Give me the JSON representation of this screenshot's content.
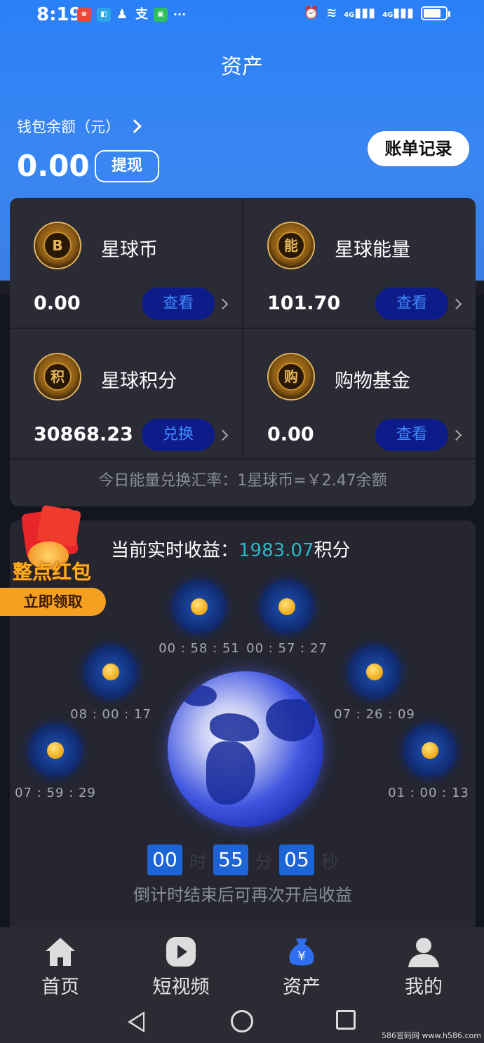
{
  "status_bar": {
    "time": "8:19",
    "dots": "···",
    "net1": "4G",
    "net2": "4G"
  },
  "header": {
    "title": "资产"
  },
  "wallet": {
    "label": "钱包余额（元）",
    "amount": "0.00",
    "withdraw_label": "提现",
    "bill_label": "账单记录"
  },
  "assets": [
    {
      "name": "星球币",
      "value": "0.00",
      "action": "查看",
      "coin_text": "B"
    },
    {
      "name": "星球能量",
      "value": "101.70",
      "action": "查看",
      "coin_text": "能"
    },
    {
      "name": "星球积分",
      "value": "30868.23",
      "action": "兑换",
      "coin_text": "积"
    },
    {
      "name": "购物基金",
      "value": "0.00",
      "action": "查看",
      "coin_text": "购"
    }
  ],
  "rate_text": "今日能量兑换汇率：1星球币=￥2.47余额",
  "earnings": {
    "prefix": "当前实时收益：",
    "value": "1983.07",
    "suffix": "积分",
    "orbs": [
      {
        "time": "00 : 58 : 51"
      },
      {
        "time": "00 : 57 : 27"
      },
      {
        "time": "08 : 00 : 17"
      },
      {
        "time": "07 : 26 : 09"
      },
      {
        "time": "07 : 59 : 29"
      },
      {
        "time": "01 : 00 : 13"
      }
    ],
    "countdown": {
      "hours": "00",
      "hours_unit": "时",
      "minutes": "55",
      "minutes_unit": "分",
      "seconds": "05",
      "seconds_unit": "秒"
    },
    "note": "倒计时结束后可再次开启收益"
  },
  "red_packet": {
    "title": "整点红包",
    "button": "立即领取"
  },
  "tabs": [
    {
      "label": "首页",
      "icon": "home-icon"
    },
    {
      "label": "短视频",
      "icon": "play-icon"
    },
    {
      "label": "资产",
      "icon": "money-bag-icon"
    },
    {
      "label": "我的",
      "icon": "user-icon"
    }
  ],
  "watermark": "586官码网 www.h586.com"
}
